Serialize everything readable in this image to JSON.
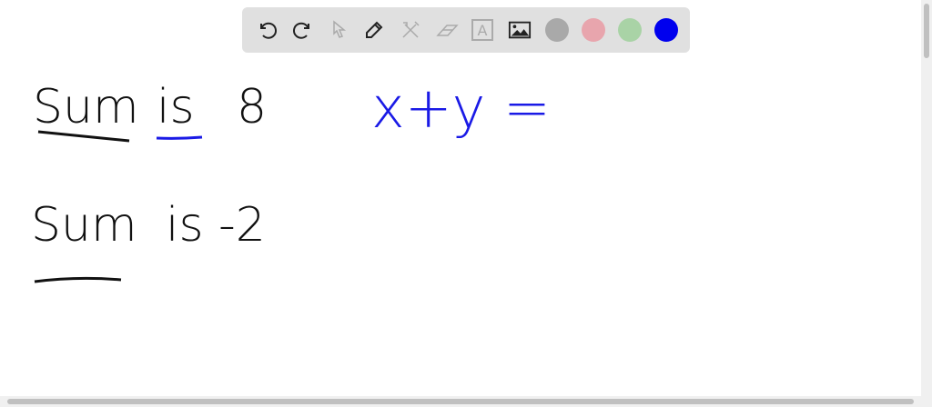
{
  "toolbar": {
    "tools": [
      "undo-icon",
      "redo-icon",
      "select-icon",
      "pen-icon",
      "tools-icon",
      "eraser-icon",
      "text-icon",
      "image-icon"
    ],
    "text_tool_label": "A",
    "colors": [
      "#a9a9a9",
      "#e8a5ad",
      "#a9d3a6",
      "#0000ee"
    ]
  },
  "canvas": {
    "line1": {
      "word1": "Sum",
      "word2": "is",
      "word3": "8"
    },
    "equation": "x+y =",
    "line2": {
      "word1": "Sum",
      "word2": "is",
      "word3": "-2"
    },
    "ink_black": "#111111",
    "ink_blue": "#1a1ae6"
  }
}
